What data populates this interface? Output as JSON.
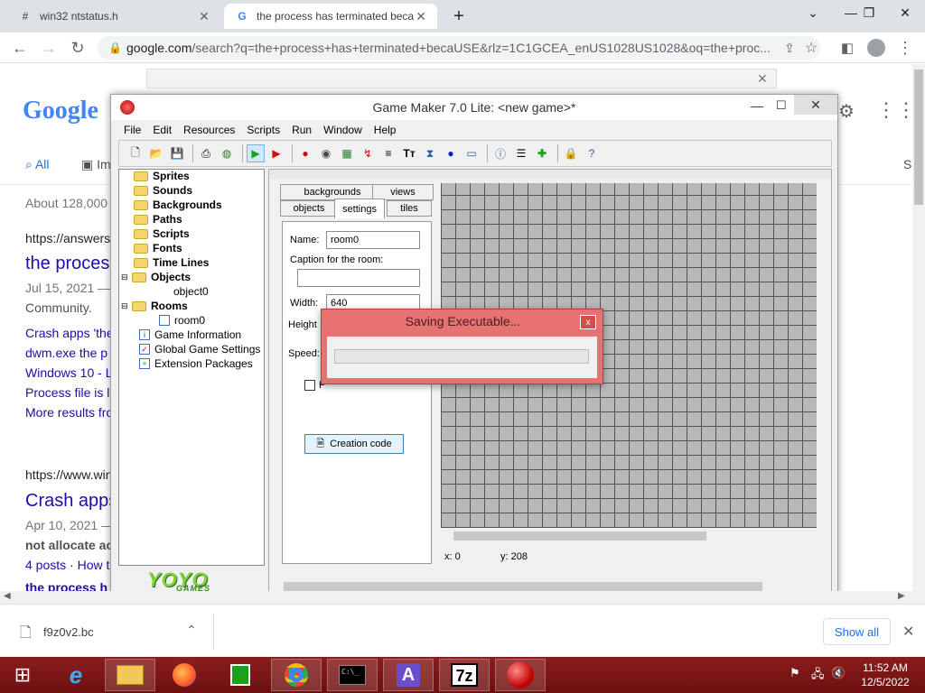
{
  "browser": {
    "tabs": [
      {
        "title": "win32 ntstatus.h",
        "favicon": "#"
      },
      {
        "title": "the process has terminated beca",
        "favicon": "G"
      }
    ],
    "url_host": "google.com",
    "url_path": "/search?q=the+process+has+terminated+becaUSE&rlz=1C1GCEA_enUS1028US1028&oq=the+proc..."
  },
  "google": {
    "logo": "Google",
    "tab_all": "All",
    "tab_images": "Im",
    "result_count": "About 128,000",
    "results": [
      {
        "url": "https://answers",
        "title": "the proces",
        "date": "Jul 15, 2021 —",
        "snippet": "Community."
      },
      {
        "url": "https://www.win",
        "title": "Crash apps",
        "date": "Apr 10, 2021 —",
        "snippet": "not allocate ac"
      }
    ],
    "sub_links": [
      "Crash apps 'the",
      "dwm.exe the p",
      "Windows 10 - L",
      "Process file is l",
      "More results fro"
    ],
    "posts": "4 posts · How t",
    "footer_link": "the process h"
  },
  "gm": {
    "title": "Game Maker 7.0 Lite: <new game>*",
    "menu": [
      "File",
      "Edit",
      "Resources",
      "Scripts",
      "Run",
      "Window",
      "Help"
    ],
    "tree": {
      "sprites": "Sprites",
      "sounds": "Sounds",
      "backgrounds": "Backgrounds",
      "paths": "Paths",
      "scripts": "Scripts",
      "fonts": "Fonts",
      "timelines": "Time Lines",
      "objects": "Objects",
      "object0": "object0",
      "rooms": "Rooms",
      "room0": "room0",
      "game_info": "Game Information",
      "global_settings": "Global Game Settings",
      "extensions": "Extension Packages"
    },
    "logo_main": "YOYO",
    "logo_sub": "GAMES",
    "room": {
      "tabs_top": [
        "backgrounds",
        "views"
      ],
      "tabs_bottom": [
        "objects",
        "settings",
        "tiles"
      ],
      "name_label": "Name:",
      "name_value": "room0",
      "caption_label": "Caption for the room:",
      "caption_value": "",
      "width_label": "Width:",
      "width_value": "640",
      "height_label": "Height",
      "speed_label": "Speed:",
      "persistent_label": "P",
      "creation_code": "Creation code",
      "status_x": "x: 0",
      "status_y": "y: 208"
    }
  },
  "dialog": {
    "title": "Saving Executable...",
    "close": "x",
    "progress": 0
  },
  "shelf": {
    "file": "f9z0v2.bc",
    "show_all": "Show all"
  },
  "taskbar": {
    "time": "11:52 AM",
    "date": "12/5/2022"
  }
}
